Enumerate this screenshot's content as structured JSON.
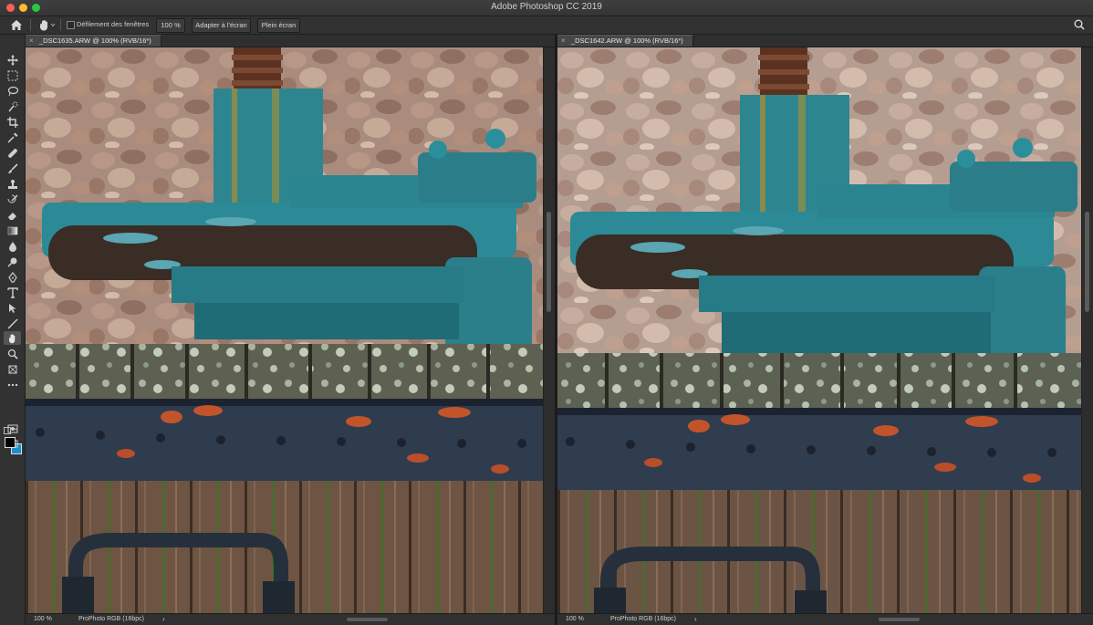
{
  "window": {
    "title": "Adobe Photoshop CC 2019"
  },
  "options_bar": {
    "scroll_all_windows_label": "Défilement des fenêtres",
    "scroll_all_windows_checked": false,
    "zoom_100_label": "100 %",
    "fit_screen_label": "Adapter à l'écran",
    "fill_screen_label": "Plein écran"
  },
  "toolbar": {
    "tools": [
      "move-icon",
      "marquee-icon",
      "lasso-icon",
      "quick-selection-icon",
      "crop-icon",
      "eyedropper-icon",
      "healing-brush-icon",
      "brush-icon",
      "clone-stamp-icon",
      "history-brush-icon",
      "eraser-icon",
      "gradient-icon",
      "blur-icon",
      "dodge-icon",
      "pen-icon",
      "type-icon",
      "path-selection-icon",
      "line-icon",
      "hand-icon",
      "zoom-icon",
      "artboard-icon",
      "more-icon"
    ],
    "active_tool": "hand-icon",
    "foreground_color": "#000000",
    "background_color": "#1d8fd0"
  },
  "documents": [
    {
      "tab_label": "_DSC1635.ARW @ 100% (RVB/16*)",
      "zoom": "100 %",
      "profile": "ProPhoto RGB (16bpc)"
    },
    {
      "tab_label": "_DSC1642.ARW @ 100% (RVB/16*)",
      "zoom": "100 %",
      "profile": "ProPhoto RGB (16bpc)"
    }
  ],
  "colors": {
    "chrome_dark": "#323232",
    "wall": "#a88c7c",
    "teal_metal": "#2e8a94",
    "band": "#2c3a4c",
    "rust": "#c2542c",
    "wood": "#6e5442"
  }
}
